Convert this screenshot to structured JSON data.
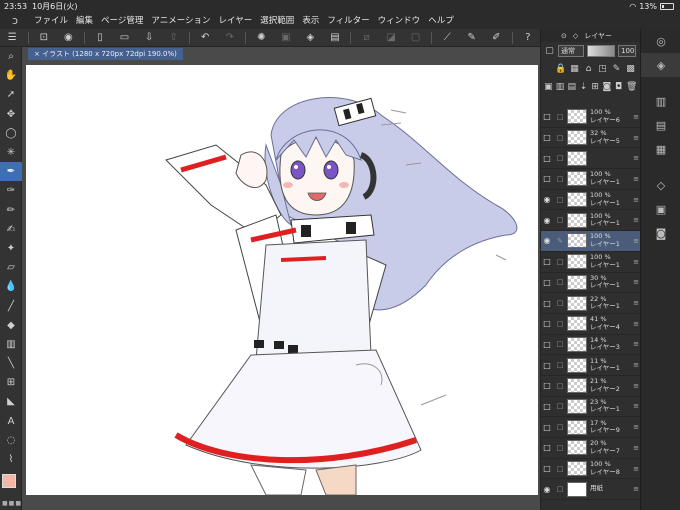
{
  "status": {
    "time": "23:53",
    "date": "10月6日(火)",
    "battery": "13%"
  },
  "menu": [
    "ファイル",
    "編集",
    "ページ管理",
    "アニメーション",
    "レイヤー",
    "選択範囲",
    "表示",
    "フィルター",
    "ウィンドウ",
    "ヘルプ"
  ],
  "doc_tab": "× イラスト (1280 x 720px 72dpi 190.0%)",
  "layer_panel": {
    "title": "レイヤー",
    "blend": "通常",
    "opacity": "100",
    "layers": [
      {
        "pct": "100 %",
        "name": "レイヤー6",
        "visible": false,
        "selected": false,
        "thumb": "transparent"
      },
      {
        "pct": "32 %",
        "name": "レイヤー5",
        "visible": false,
        "selected": false,
        "thumb": "transparent"
      },
      {
        "pct": "",
        "name": "",
        "visible": false,
        "selected": false,
        "thumb": "transparent"
      },
      {
        "pct": "100 %",
        "name": "レイヤー1",
        "visible": false,
        "selected": false,
        "thumb": "transparent"
      },
      {
        "pct": "100 %",
        "name": "レイヤー1",
        "visible": true,
        "selected": false,
        "thumb": "transparent"
      },
      {
        "pct": "100 %",
        "name": "レイヤー1",
        "visible": true,
        "selected": false,
        "thumb": "transparent"
      },
      {
        "pct": "100 %",
        "name": "レイヤー1",
        "visible": true,
        "selected": true,
        "thumb": "transparent"
      },
      {
        "pct": "100 %",
        "name": "レイヤー1",
        "visible": false,
        "selected": false,
        "thumb": "transparent"
      },
      {
        "pct": "30 %",
        "name": "レイヤー1",
        "visible": false,
        "selected": false,
        "thumb": "transparent"
      },
      {
        "pct": "22 %",
        "name": "レイヤー1",
        "visible": false,
        "selected": false,
        "thumb": "transparent"
      },
      {
        "pct": "41 %",
        "name": "レイヤー4",
        "visible": false,
        "selected": false,
        "thumb": "transparent"
      },
      {
        "pct": "14 %",
        "name": "レイヤー3",
        "visible": false,
        "selected": false,
        "thumb": "transparent"
      },
      {
        "pct": "11 %",
        "name": "レイヤー1",
        "visible": false,
        "selected": false,
        "thumb": "transparent"
      },
      {
        "pct": "21 %",
        "name": "レイヤー2",
        "visible": false,
        "selected": false,
        "thumb": "transparent"
      },
      {
        "pct": "23 %",
        "name": "レイヤー1",
        "visible": false,
        "selected": false,
        "thumb": "transparent"
      },
      {
        "pct": "17 %",
        "name": "レイヤー9",
        "visible": false,
        "selected": false,
        "thumb": "transparent"
      },
      {
        "pct": "20 %",
        "name": "レイヤー7",
        "visible": false,
        "selected": false,
        "thumb": "transparent"
      },
      {
        "pct": "100 %",
        "name": "レイヤー8",
        "visible": false,
        "selected": false,
        "thumb": "transparent"
      },
      {
        "pct": "",
        "name": "用紙",
        "visible": true,
        "selected": false,
        "thumb": "white"
      }
    ]
  },
  "colors": {
    "accent": "#3e6fb5",
    "fg_color": "#f2b7a6",
    "bg_color": "#ffffff",
    "selected_layer": "#4a5c7a"
  }
}
